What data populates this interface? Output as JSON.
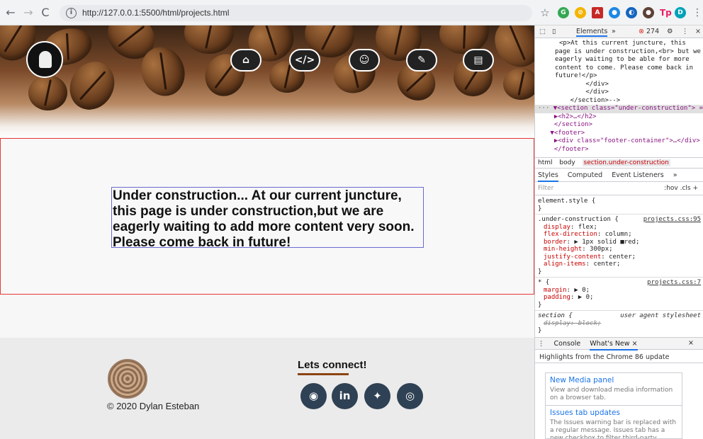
{
  "browser": {
    "url": "http://127.0.0.1:5500/html/projects.html",
    "back": "←",
    "forward": "→",
    "reload": "C"
  },
  "site": {
    "nav_icons": [
      "home-icon",
      "code-icon",
      "about-icon",
      "pencil-icon",
      "contact-card-icon"
    ],
    "under_construction": "Under construction... At our current juncture, this page is under construction,but we are eagerly waiting to add more content very soon. Please come back in future!",
    "copyright": "© 2020 Dylan Esteban",
    "connect": "Lets connect!",
    "social": [
      "github-icon",
      "linkedin-icon",
      "twitter-icon",
      "instagram-icon"
    ]
  },
  "devtools": {
    "tab_elements": "Elements",
    "more": "»",
    "error_count": "274",
    "tree": [
      "<p>At this current juncture, this",
      "page is under construction,<br> but we",
      "eagerly waiting to be able for more",
      "content to come. Please come back in",
      "future!</p>",
      "        </div>",
      "        </div>",
      "    </section>-->"
    ],
    "sel_row": "▼<section class=\"under-construction\"> == $0",
    "tree2": [
      "  ▶<h2>…</h2>",
      "  </section>",
      " ▼<footer>",
      "  ▶<div class=\"footer-container\">…</div>",
      "  </footer>"
    ],
    "crumbs": [
      "html",
      "body",
      "section.under-construction"
    ],
    "style_tabs": [
      "Styles",
      "Computed",
      "Event Listeners",
      "»"
    ],
    "filter_placeholder": "Filter",
    "filter_right": ":hov  .cls  +",
    "rules": {
      "element_style": "element.style {",
      "close": "}",
      "uc_selector": ".under-construction {",
      "uc_src": "projects.css:95",
      "uc_props": [
        [
          "display",
          "flex;"
        ],
        [
          "flex-direction",
          "column;"
        ],
        [
          "border",
          "▶ 1px solid ■red;"
        ],
        [
          "min-height",
          "300px;"
        ],
        [
          "justify-content",
          "center;"
        ],
        [
          "align-items",
          "center;"
        ]
      ],
      "star_selector": "* {",
      "star_src": "projects.css:7",
      "star_props": [
        [
          "margin",
          "▶ 0;"
        ],
        [
          "padding",
          "▶ 0;"
        ]
      ],
      "section_selector": "section {",
      "section_src": "user agent stylesheet",
      "section_prop": "display: block;"
    },
    "drawer": [
      "Console",
      "What's New ×"
    ],
    "highlights": "Highlights from the Chrome 86 update",
    "cards": [
      {
        "title": "New Media panel",
        "body": "View and download media information on a browser tab."
      },
      {
        "title": "Issues tab updates",
        "body": "The Issues warning bar is replaced with a regular message. Issues tab has a new checkbox to filter third-party cookie issues."
      }
    ]
  }
}
